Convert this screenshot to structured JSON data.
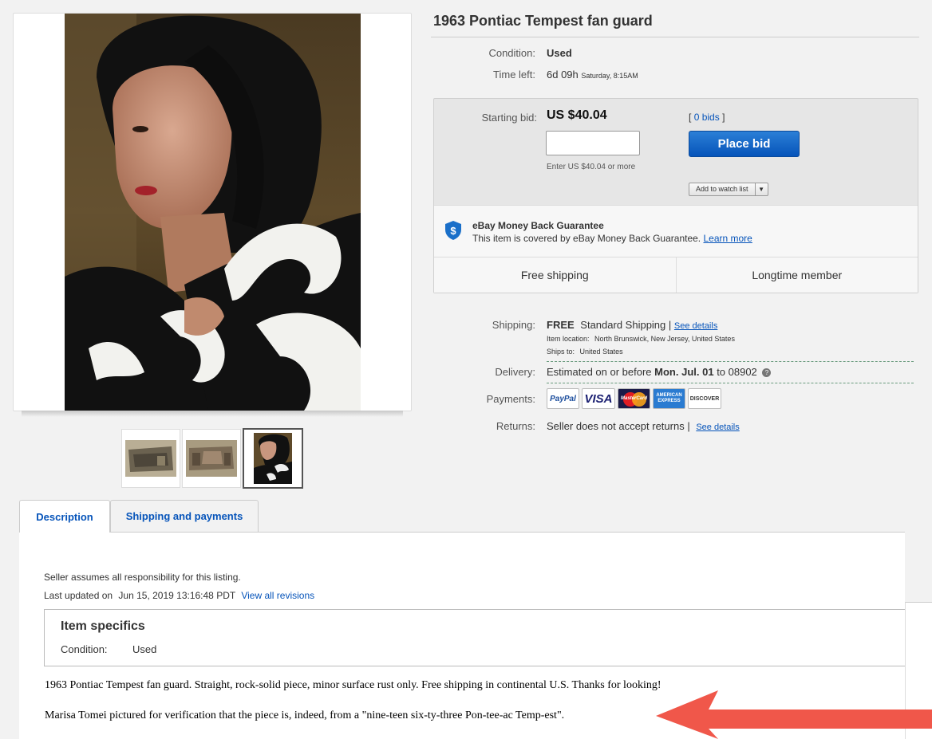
{
  "title": "1963 Pontiac Tempest fan guard",
  "condition": {
    "label": "Condition:",
    "value": "Used"
  },
  "time_left": {
    "label": "Time left:",
    "value": "6d 09h",
    "ends": "Saturday, 8:15AM"
  },
  "bid": {
    "label": "Starting bid:",
    "price": "US $40.04",
    "bids_open": "[",
    "bids_link": "0 bids",
    "bids_close": "]",
    "input_value": "",
    "hint": "Enter US $40.04 or more",
    "place_bid_label": "Place bid",
    "watch_label": "Add to watch list"
  },
  "guarantee": {
    "title": "eBay Money Back Guarantee",
    "text": "This item is covered by eBay Money Back Guarantee.",
    "link": "Learn more"
  },
  "features": [
    "Free shipping",
    "Longtime member"
  ],
  "shipping": {
    "label": "Shipping:",
    "free": "FREE",
    "method": "Standard Shipping |",
    "details_link": "See details",
    "location_label": "Item location:",
    "location": "North Brunswick, New Jersey, United States",
    "ships_to_label": "Ships to:",
    "ships_to": "United States"
  },
  "delivery": {
    "label": "Delivery:",
    "text": "Estimated on or before",
    "date": "Mon. Jul. 01",
    "to": "to 08902"
  },
  "payments": {
    "label": "Payments:",
    "methods": [
      "PayPal",
      "VISA",
      "MasterCard",
      "AMERICAN EXPRESS",
      "DISCOVER"
    ]
  },
  "returns": {
    "label": "Returns:",
    "text": "Seller does not accept returns |",
    "details_link": "See details"
  },
  "tabs": [
    "Description",
    "Shipping and payments"
  ],
  "description": {
    "responsibility": "Seller assumes all responsibility for this listing.",
    "updated_label": "Last updated on",
    "updated": "Jun 15, 2019 13:16:48 PDT",
    "revisions_link": "View all revisions",
    "specifics_title": "Item specifics",
    "specifics_condition_label": "Condition:",
    "specifics_condition_value": "Used",
    "para1": "1963 Pontiac Tempest fan guard. Straight, rock-solid piece, minor surface rust only. Free shipping in continental U.S. Thanks for looking!",
    "para2": "Marisa Tomei pictured for verification that the piece is, indeed, from a \"nine-teen six-ty-three Pon-tee-ac Temp-est\"."
  },
  "colors": {
    "accent": "#0654ba",
    "annotation_arrow": "#f0574a"
  }
}
